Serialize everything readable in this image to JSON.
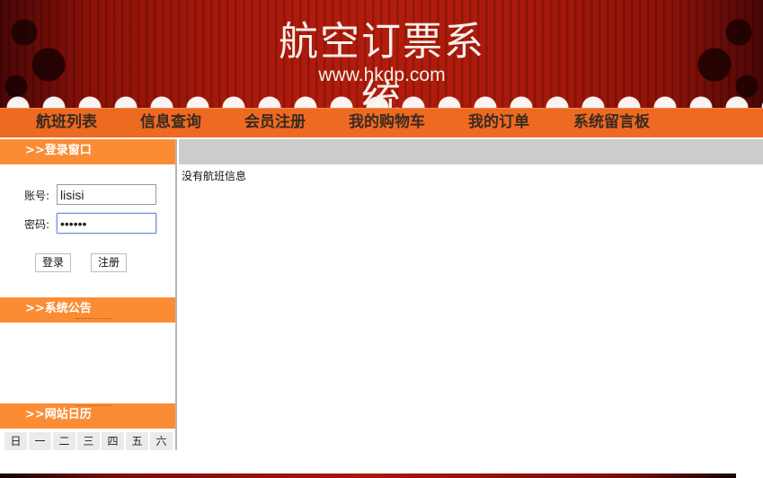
{
  "header": {
    "title": "航空订票系统",
    "url": "www.hkdp.com"
  },
  "nav": {
    "items": [
      {
        "label": "航班列表"
      },
      {
        "label": "信息查询"
      },
      {
        "label": "会员注册"
      },
      {
        "label": "我的购物车"
      },
      {
        "label": "我的订单"
      },
      {
        "label": "系统留言板"
      }
    ]
  },
  "login": {
    "title": ">>登录窗口",
    "account_label": "账号:",
    "account_value": "lisisi",
    "password_label": "密码:",
    "password_value": "••••••",
    "login_button": "登录",
    "register_button": "注册"
  },
  "notice": {
    "title": ">>系统公告"
  },
  "calendar": {
    "title": ">>网站日历",
    "weekdays": [
      "日",
      "一",
      "二",
      "三",
      "四",
      "五",
      "六"
    ]
  },
  "content": {
    "empty_message": "没有航班信息"
  },
  "colors": {
    "nav_bg": "#ee6a22",
    "panel_head_bg": "#fb8c34",
    "banner_red": "#a8190b"
  }
}
